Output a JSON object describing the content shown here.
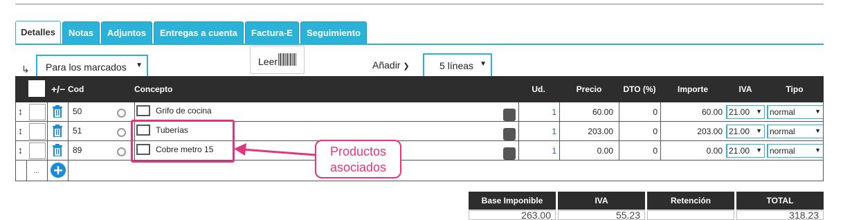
{
  "tabs": [
    {
      "label": "Detalles",
      "active": true
    },
    {
      "label": "Notas"
    },
    {
      "label": "Adjuntos"
    },
    {
      "label": "Entregas a cuenta"
    },
    {
      "label": "Factura-E"
    },
    {
      "label": "Seguimiento"
    }
  ],
  "controls": {
    "bulk_action": "Para los marcados",
    "leer_label": "Leer",
    "anadir_label": "Añadir",
    "lines_select": "5 líneas"
  },
  "table": {
    "headers": {
      "cod": "Cod",
      "concepto": "Concepto",
      "ud": "Ud.",
      "precio": "Precio",
      "dto": "DTO (%)",
      "importe": "Importe",
      "iva": "IVA",
      "tipo": "Tipo"
    },
    "rows": [
      {
        "cod": "50",
        "concepto": "Grifo de cocina",
        "ud": "1",
        "precio": "60.00",
        "dto": "0",
        "importe": "60.00",
        "iva": "21.00",
        "tipo": "normal"
      },
      {
        "cod": "51",
        "concepto": "Tuberías",
        "ud": "1",
        "precio": "203.00",
        "dto": "0",
        "importe": "203.00",
        "iva": "21.00",
        "tipo": "normal"
      },
      {
        "cod": "89",
        "concepto": "Cobre metro 15",
        "ud": "1",
        "precio": "0.00",
        "dto": "0",
        "importe": "0.00",
        "iva": "21.00",
        "tipo": "normal"
      }
    ],
    "ellipsis": "..."
  },
  "callout": {
    "line1": "Productos",
    "line2": "asociados"
  },
  "totals": {
    "headers": [
      "Base Imponible",
      "IVA",
      "Retención",
      "TOTAL"
    ],
    "values": [
      "263.00",
      "55.23",
      "",
      "318.23"
    ]
  },
  "colors": {
    "accent": "#2ab2d8",
    "header": "#2d2d2d",
    "highlight": "#e03580",
    "icon_blue": "#1a8bd6"
  }
}
